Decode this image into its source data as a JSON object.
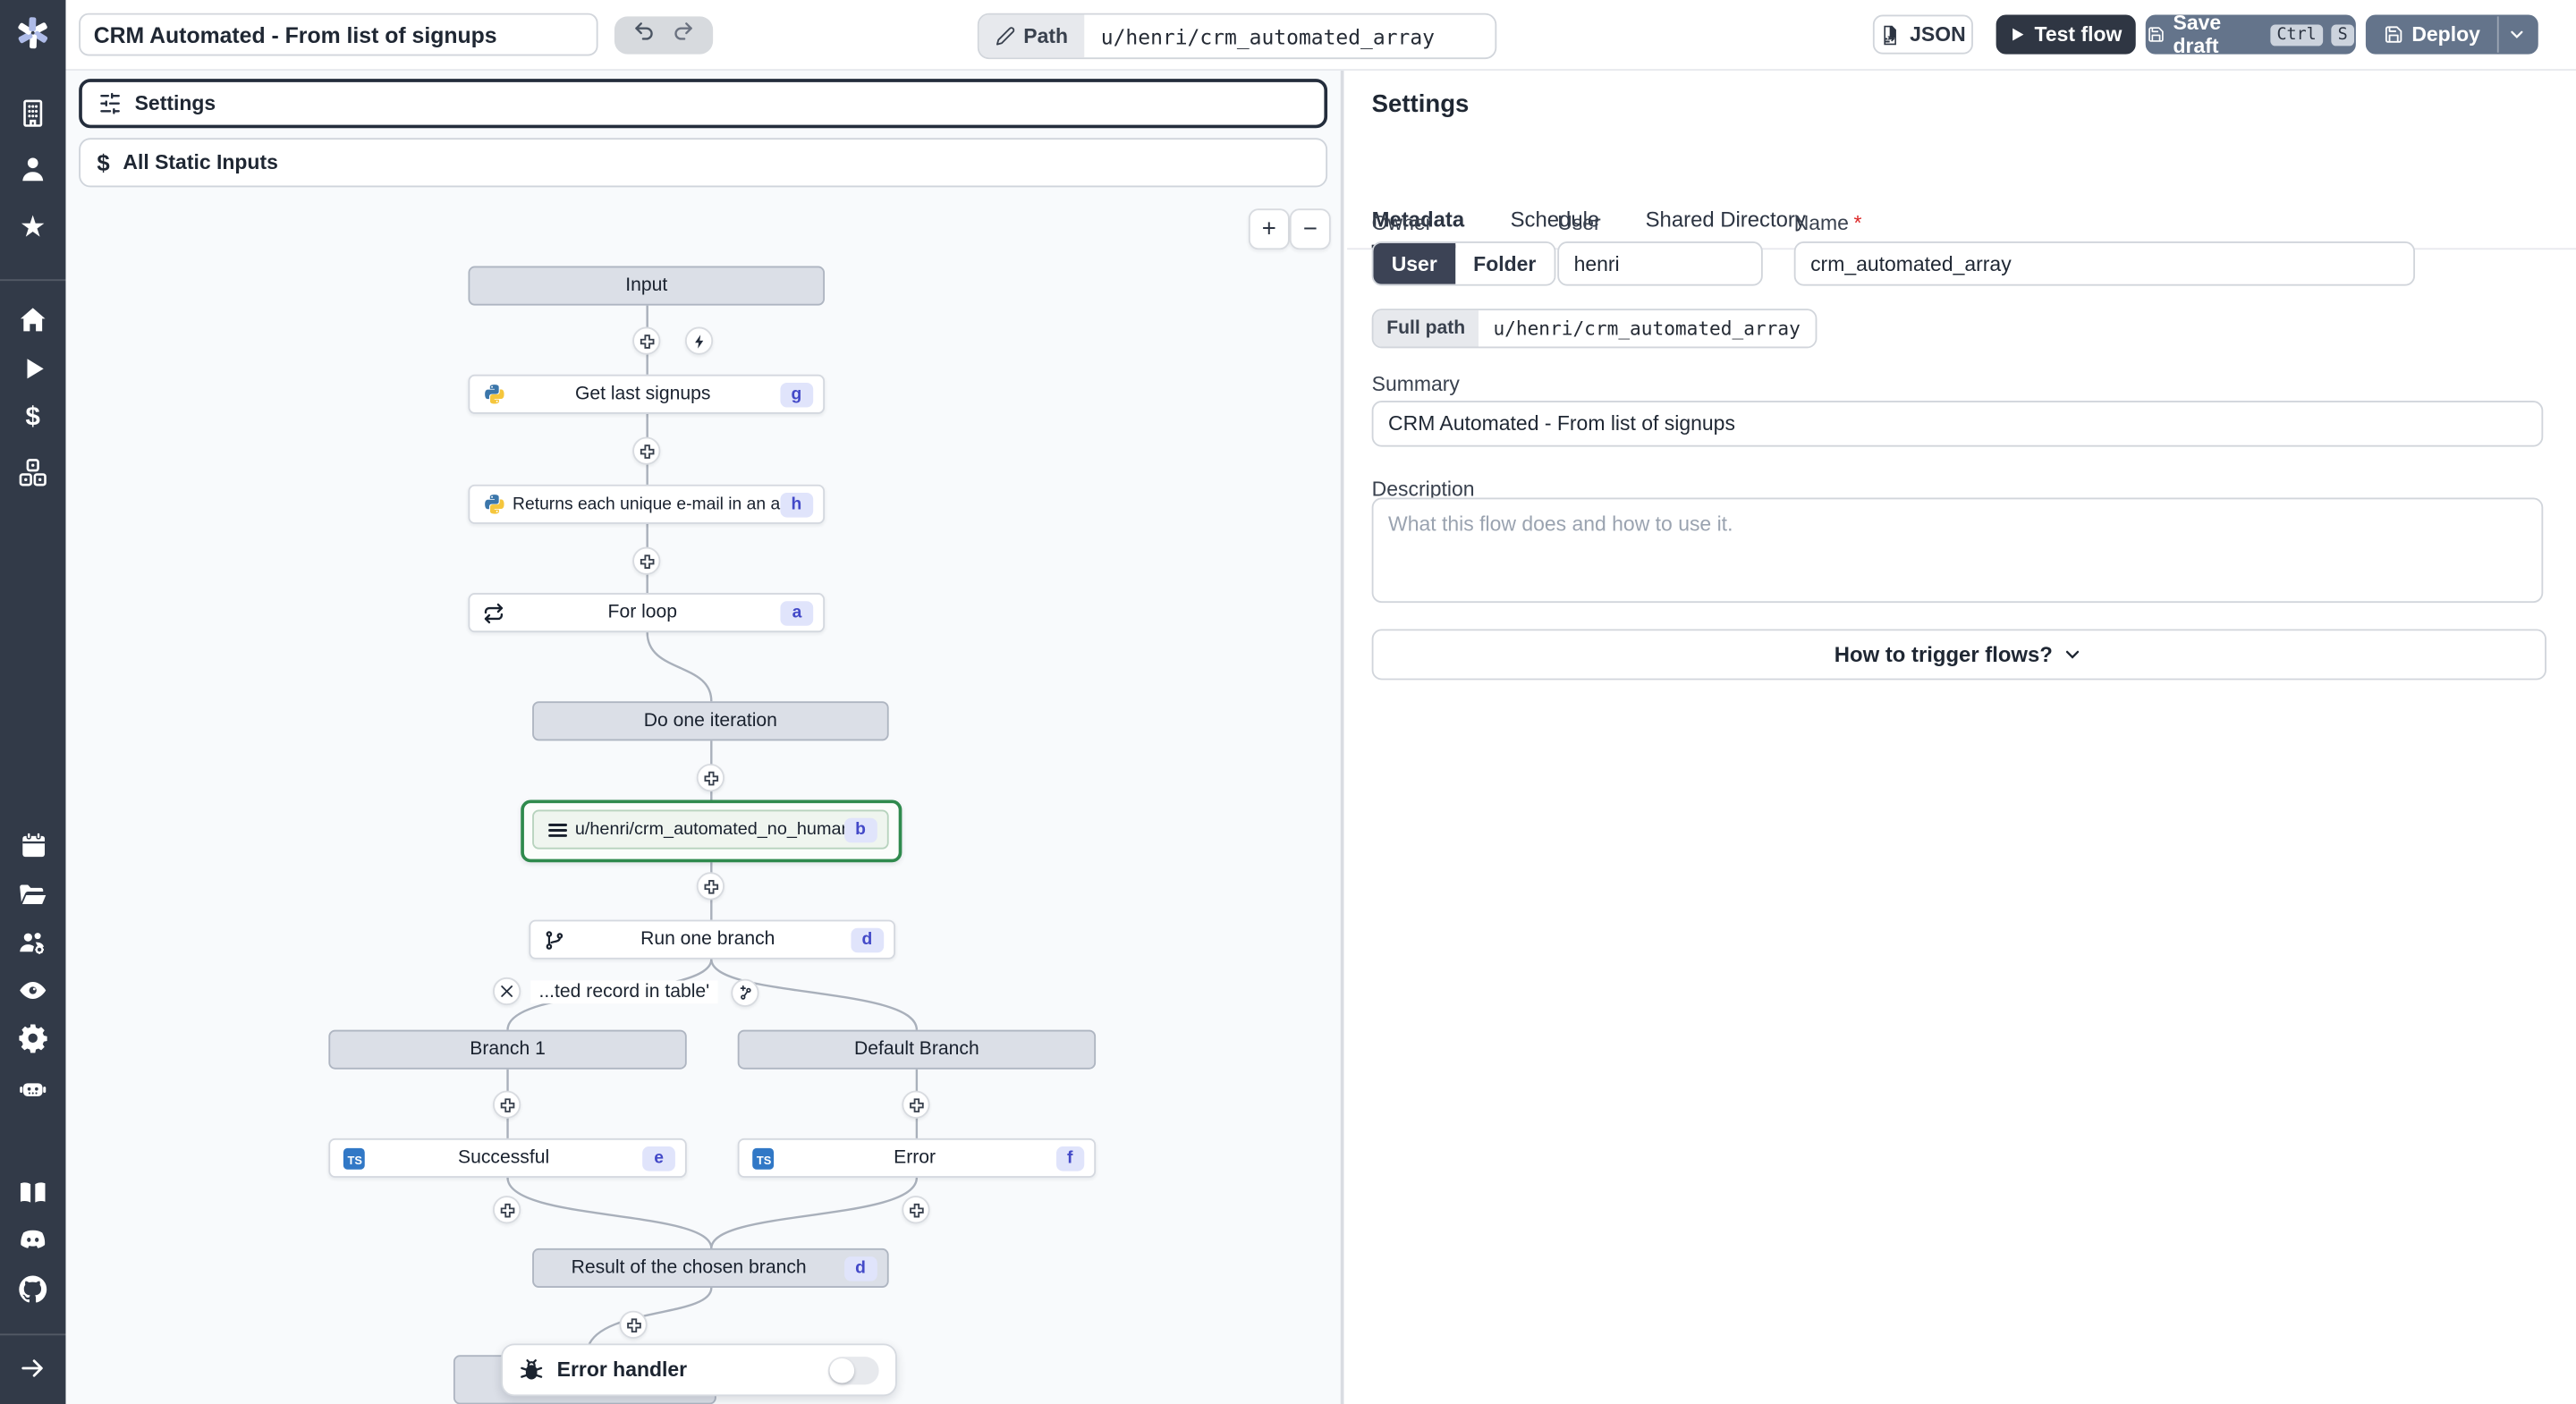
{
  "topbar": {
    "title_value": "CRM Automated - From list of signups",
    "path_label": "Path",
    "path_value": "u/henri/crm_automated_array",
    "json_label": "JSON",
    "test_flow_label": "Test flow",
    "save_draft_label": "Save draft",
    "kbd_ctrl": "Ctrl",
    "kbd_s": "S",
    "deploy_label": "Deploy"
  },
  "flow_panel": {
    "settings_bar_label": "Settings",
    "static_inputs_label": "All Static Inputs",
    "zoom_in": "+",
    "zoom_out": "−",
    "nodes": {
      "input": {
        "label": "Input"
      },
      "get_last_signups": {
        "label": "Get last signups",
        "badge": "g"
      },
      "unique_emails": {
        "label": "Returns each unique e-mail in an array",
        "badge": "h"
      },
      "for_loop": {
        "label": "For loop",
        "badge": "a"
      },
      "do_one_iteration": {
        "label": "Do one iteration"
      },
      "subflow": {
        "label": "u/henri/crm_automated_no_human",
        "badge": "b"
      },
      "run_one_branch": {
        "label": "Run one branch",
        "badge": "d"
      },
      "branch_predicate": {
        "label": "...ted record in table'"
      },
      "branch_1": {
        "label": "Branch 1"
      },
      "default_branch": {
        "label": "Default Branch"
      },
      "successful": {
        "label": "Successful",
        "badge": "e"
      },
      "error": {
        "label": "Error",
        "badge": "f"
      },
      "result": {
        "label": "Result of the chosen branch",
        "badge": "d"
      },
      "error_handler": {
        "label": "Error handler"
      }
    }
  },
  "settings_panel": {
    "heading": "Settings",
    "tabs": [
      {
        "label": "Metadata"
      },
      {
        "label": "Schedule"
      },
      {
        "label": "Shared Directory"
      }
    ],
    "owner": {
      "label": "Owner",
      "options": [
        {
          "label": "User"
        },
        {
          "label": "Folder"
        }
      ],
      "selected": "User"
    },
    "user": {
      "label": "User",
      "value": "henri"
    },
    "name": {
      "label": "Name",
      "required_mark": "*",
      "value": "crm_automated_array"
    },
    "full_path": {
      "label": "Full path",
      "value": "u/henri/crm_automated_array"
    },
    "summary": {
      "label": "Summary",
      "value": "CRM Automated - From list of signups"
    },
    "description": {
      "label": "Description",
      "placeholder": "What this flow does and how to use it."
    },
    "trigger_button_label": "How to trigger flows?"
  },
  "sidebar": {
    "icons": [
      "windmill-logo",
      "workspace-icon",
      "user-icon",
      "favorites-star-icon",
      "home-icon",
      "runs-play-icon",
      "variables-dollar-icon",
      "resources-cubes-icon",
      "schedules-calendar-icon",
      "folders-icon",
      "groups-gear-icon",
      "audit-eye-icon",
      "settings-gear-icon",
      "workers-robot-icon",
      "docs-book-icon",
      "discord-icon",
      "github-icon",
      "collapse-arrow-icon"
    ]
  },
  "colors": {
    "sidebar_bg": "#323a48",
    "slate_button": "#64748b",
    "dark_button": "#2f3643",
    "canvas_bg": "#f8fafc",
    "gray_node_bg": "#dbdfe7",
    "badge_bg": "#e0e4fb",
    "badge_text": "#4349c8",
    "selected_green": "#2f8a4d",
    "ts_blue": "#3178c6"
  }
}
